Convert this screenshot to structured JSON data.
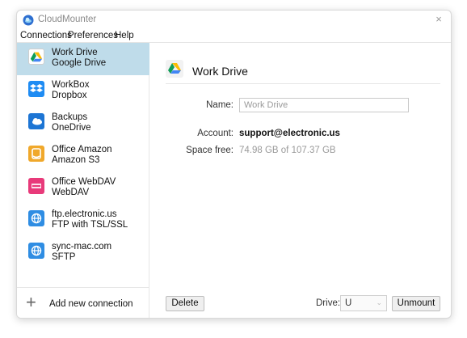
{
  "app": {
    "title": "CloudMounter",
    "close_icon": "×"
  },
  "menu": [
    "Connections",
    "Preferences",
    "Help"
  ],
  "connections": [
    {
      "name": "Work Drive",
      "service": "Google Drive",
      "icon": "google-drive-icon",
      "selected": true
    },
    {
      "name": "WorkBox",
      "service": "Dropbox",
      "icon": "dropbox-icon"
    },
    {
      "name": "Backups",
      "service": "OneDrive",
      "icon": "onedrive-icon"
    },
    {
      "name": "Office Amazon",
      "service": "Amazon S3",
      "icon": "amazon-s3-icon"
    },
    {
      "name": "Office WebDAV",
      "service": "WebDAV",
      "icon": "webdav-icon"
    },
    {
      "name": "ftp.electronic.us",
      "service": "FTP with TSL/SSL",
      "icon": "ftp-icon"
    },
    {
      "name": "sync-mac.com",
      "service": "SFTP",
      "icon": "sftp-icon"
    }
  ],
  "sidebar_footer": {
    "plus": "+",
    "label": "Add new connection"
  },
  "details": {
    "title": "Work Drive",
    "name_label": "Name:",
    "name_value": "Work Drive",
    "account_label": "Account:",
    "account_value": "support@electronic.us",
    "space_label": "Space free:",
    "space_value": "74.98 GB of 107.37 GB"
  },
  "footer": {
    "delete_label": "Delete",
    "drive_label": "Drive:",
    "drive_value": "U",
    "drive_arrow": "⌄",
    "unmount_label": "Unmount"
  },
  "colors": {
    "selected_row": "#bfdcea",
    "google_drive": "#ffffff",
    "dropbox": "#1f8cf3",
    "onedrive": "#1d75d4",
    "amazon": "#f0a82b",
    "webdav": "#e83a7a",
    "ftp": "#2f8de3",
    "sftp": "#2f8de3"
  }
}
